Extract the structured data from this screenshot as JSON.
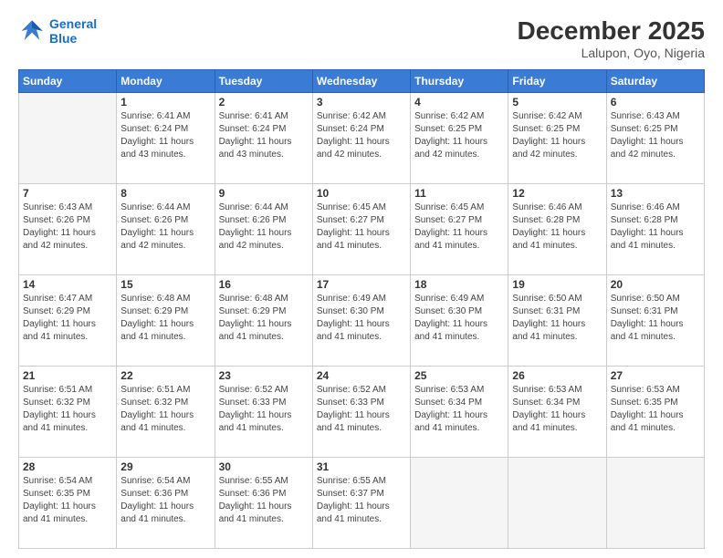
{
  "logo": {
    "line1": "General",
    "line2": "Blue"
  },
  "header": {
    "month": "December 2025",
    "location": "Lalupon, Oyo, Nigeria"
  },
  "weekdays": [
    "Sunday",
    "Monday",
    "Tuesday",
    "Wednesday",
    "Thursday",
    "Friday",
    "Saturday"
  ],
  "weeks": [
    [
      {
        "day": "",
        "sunrise": "",
        "sunset": "",
        "daylight": ""
      },
      {
        "day": "1",
        "sunrise": "Sunrise: 6:41 AM",
        "sunset": "Sunset: 6:24 PM",
        "daylight": "Daylight: 11 hours and 43 minutes."
      },
      {
        "day": "2",
        "sunrise": "Sunrise: 6:41 AM",
        "sunset": "Sunset: 6:24 PM",
        "daylight": "Daylight: 11 hours and 43 minutes."
      },
      {
        "day": "3",
        "sunrise": "Sunrise: 6:42 AM",
        "sunset": "Sunset: 6:24 PM",
        "daylight": "Daylight: 11 hours and 42 minutes."
      },
      {
        "day": "4",
        "sunrise": "Sunrise: 6:42 AM",
        "sunset": "Sunset: 6:25 PM",
        "daylight": "Daylight: 11 hours and 42 minutes."
      },
      {
        "day": "5",
        "sunrise": "Sunrise: 6:42 AM",
        "sunset": "Sunset: 6:25 PM",
        "daylight": "Daylight: 11 hours and 42 minutes."
      },
      {
        "day": "6",
        "sunrise": "Sunrise: 6:43 AM",
        "sunset": "Sunset: 6:25 PM",
        "daylight": "Daylight: 11 hours and 42 minutes."
      }
    ],
    [
      {
        "day": "7",
        "sunrise": "Sunrise: 6:43 AM",
        "sunset": "Sunset: 6:26 PM",
        "daylight": "Daylight: 11 hours and 42 minutes."
      },
      {
        "day": "8",
        "sunrise": "Sunrise: 6:44 AM",
        "sunset": "Sunset: 6:26 PM",
        "daylight": "Daylight: 11 hours and 42 minutes."
      },
      {
        "day": "9",
        "sunrise": "Sunrise: 6:44 AM",
        "sunset": "Sunset: 6:26 PM",
        "daylight": "Daylight: 11 hours and 42 minutes."
      },
      {
        "day": "10",
        "sunrise": "Sunrise: 6:45 AM",
        "sunset": "Sunset: 6:27 PM",
        "daylight": "Daylight: 11 hours and 41 minutes."
      },
      {
        "day": "11",
        "sunrise": "Sunrise: 6:45 AM",
        "sunset": "Sunset: 6:27 PM",
        "daylight": "Daylight: 11 hours and 41 minutes."
      },
      {
        "day": "12",
        "sunrise": "Sunrise: 6:46 AM",
        "sunset": "Sunset: 6:28 PM",
        "daylight": "Daylight: 11 hours and 41 minutes."
      },
      {
        "day": "13",
        "sunrise": "Sunrise: 6:46 AM",
        "sunset": "Sunset: 6:28 PM",
        "daylight": "Daylight: 11 hours and 41 minutes."
      }
    ],
    [
      {
        "day": "14",
        "sunrise": "Sunrise: 6:47 AM",
        "sunset": "Sunset: 6:29 PM",
        "daylight": "Daylight: 11 hours and 41 minutes."
      },
      {
        "day": "15",
        "sunrise": "Sunrise: 6:48 AM",
        "sunset": "Sunset: 6:29 PM",
        "daylight": "Daylight: 11 hours and 41 minutes."
      },
      {
        "day": "16",
        "sunrise": "Sunrise: 6:48 AM",
        "sunset": "Sunset: 6:29 PM",
        "daylight": "Daylight: 11 hours and 41 minutes."
      },
      {
        "day": "17",
        "sunrise": "Sunrise: 6:49 AM",
        "sunset": "Sunset: 6:30 PM",
        "daylight": "Daylight: 11 hours and 41 minutes."
      },
      {
        "day": "18",
        "sunrise": "Sunrise: 6:49 AM",
        "sunset": "Sunset: 6:30 PM",
        "daylight": "Daylight: 11 hours and 41 minutes."
      },
      {
        "day": "19",
        "sunrise": "Sunrise: 6:50 AM",
        "sunset": "Sunset: 6:31 PM",
        "daylight": "Daylight: 11 hours and 41 minutes."
      },
      {
        "day": "20",
        "sunrise": "Sunrise: 6:50 AM",
        "sunset": "Sunset: 6:31 PM",
        "daylight": "Daylight: 11 hours and 41 minutes."
      }
    ],
    [
      {
        "day": "21",
        "sunrise": "Sunrise: 6:51 AM",
        "sunset": "Sunset: 6:32 PM",
        "daylight": "Daylight: 11 hours and 41 minutes."
      },
      {
        "day": "22",
        "sunrise": "Sunrise: 6:51 AM",
        "sunset": "Sunset: 6:32 PM",
        "daylight": "Daylight: 11 hours and 41 minutes."
      },
      {
        "day": "23",
        "sunrise": "Sunrise: 6:52 AM",
        "sunset": "Sunset: 6:33 PM",
        "daylight": "Daylight: 11 hours and 41 minutes."
      },
      {
        "day": "24",
        "sunrise": "Sunrise: 6:52 AM",
        "sunset": "Sunset: 6:33 PM",
        "daylight": "Daylight: 11 hours and 41 minutes."
      },
      {
        "day": "25",
        "sunrise": "Sunrise: 6:53 AM",
        "sunset": "Sunset: 6:34 PM",
        "daylight": "Daylight: 11 hours and 41 minutes."
      },
      {
        "day": "26",
        "sunrise": "Sunrise: 6:53 AM",
        "sunset": "Sunset: 6:34 PM",
        "daylight": "Daylight: 11 hours and 41 minutes."
      },
      {
        "day": "27",
        "sunrise": "Sunrise: 6:53 AM",
        "sunset": "Sunset: 6:35 PM",
        "daylight": "Daylight: 11 hours and 41 minutes."
      }
    ],
    [
      {
        "day": "28",
        "sunrise": "Sunrise: 6:54 AM",
        "sunset": "Sunset: 6:35 PM",
        "daylight": "Daylight: 11 hours and 41 minutes."
      },
      {
        "day": "29",
        "sunrise": "Sunrise: 6:54 AM",
        "sunset": "Sunset: 6:36 PM",
        "daylight": "Daylight: 11 hours and 41 minutes."
      },
      {
        "day": "30",
        "sunrise": "Sunrise: 6:55 AM",
        "sunset": "Sunset: 6:36 PM",
        "daylight": "Daylight: 11 hours and 41 minutes."
      },
      {
        "day": "31",
        "sunrise": "Sunrise: 6:55 AM",
        "sunset": "Sunset: 6:37 PM",
        "daylight": "Daylight: 11 hours and 41 minutes."
      },
      {
        "day": "",
        "sunrise": "",
        "sunset": "",
        "daylight": ""
      },
      {
        "day": "",
        "sunrise": "",
        "sunset": "",
        "daylight": ""
      },
      {
        "day": "",
        "sunrise": "",
        "sunset": "",
        "daylight": ""
      }
    ]
  ]
}
